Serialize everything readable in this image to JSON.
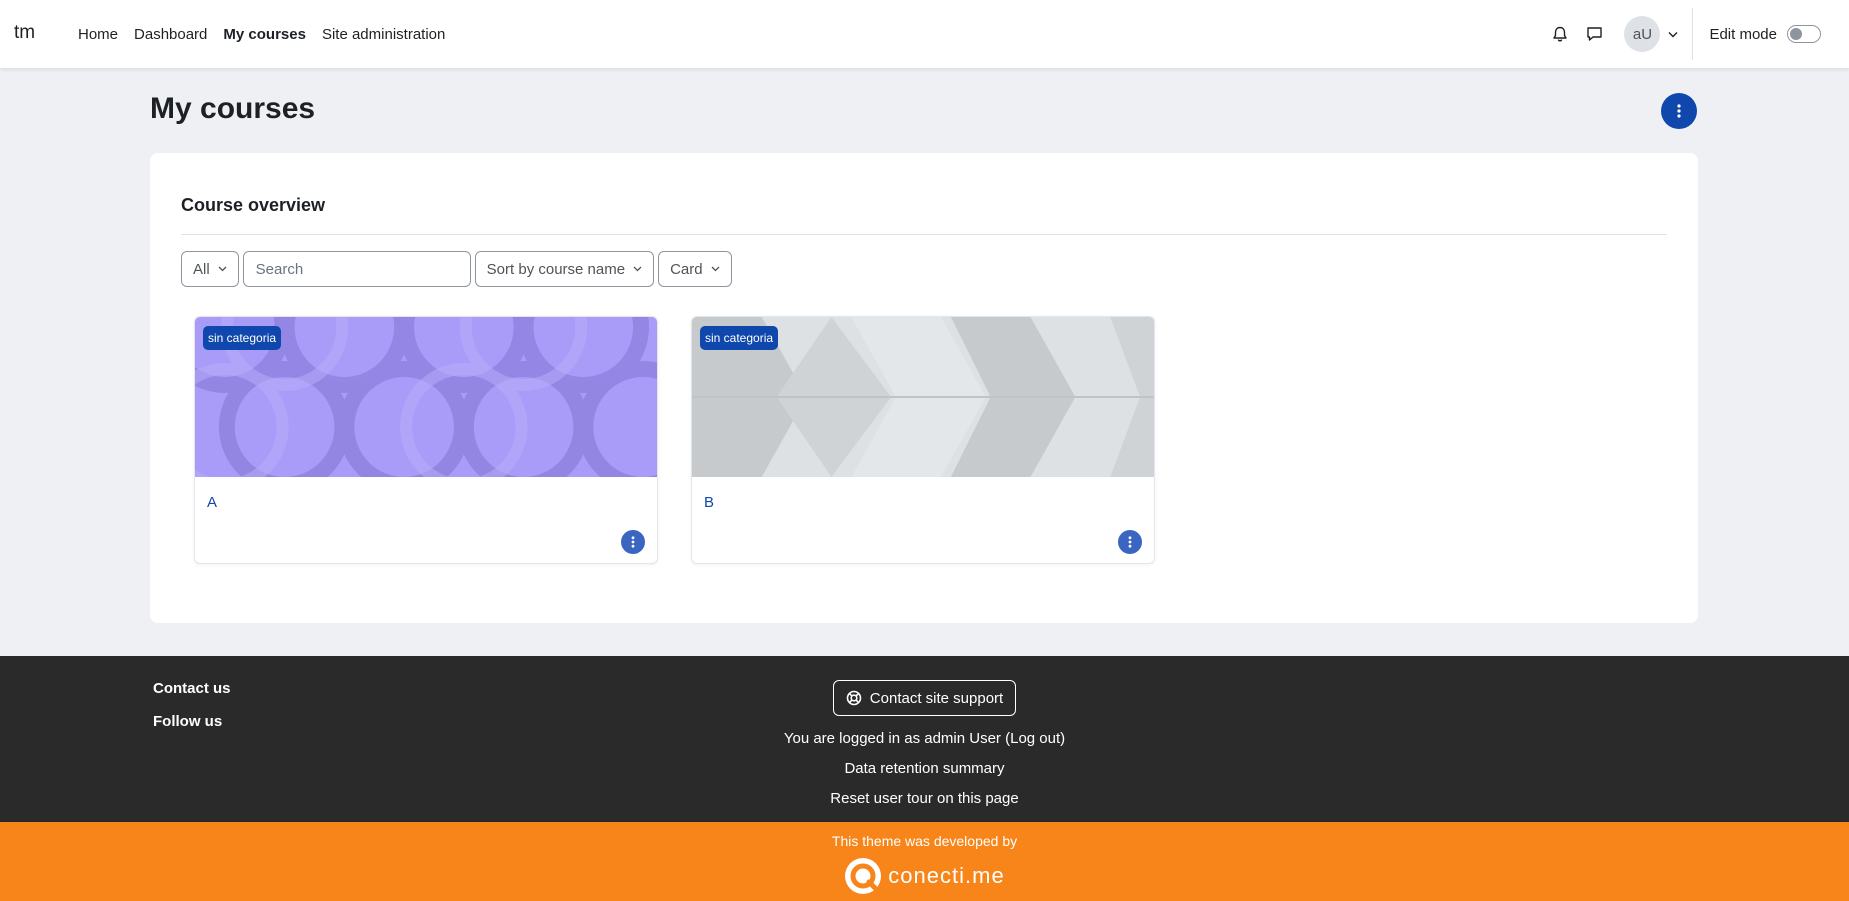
{
  "navbar": {
    "brand": "tm",
    "links": [
      {
        "label": "Home",
        "active": false
      },
      {
        "label": "Dashboard",
        "active": false
      },
      {
        "label": "My courses",
        "active": true
      },
      {
        "label": "Site administration",
        "active": false
      }
    ],
    "avatar_initials": "aU",
    "edit_mode_label": "Edit mode",
    "edit_mode_on": false
  },
  "page": {
    "title": "My courses"
  },
  "overview": {
    "title": "Course overview",
    "filter_all": "All",
    "search_placeholder": "Search",
    "sort_label": "Sort by course name",
    "view_label": "Card",
    "courses": [
      {
        "name": "A",
        "category": "sin categoria",
        "image_color": "#a99cf9"
      },
      {
        "name": "B",
        "category": "sin categoria",
        "image_color": "#dde1e4"
      }
    ]
  },
  "footer": {
    "contact_us": "Contact us",
    "follow_us": "Follow us",
    "support_button": "Contact site support",
    "logged_in_prefix": "You are logged in as ",
    "logged_in_user": "admin User",
    "logout_label": "(Log out)",
    "data_retention": "Data retention summary",
    "reset_tour": "Reset user tour on this page"
  },
  "theme_bar": {
    "note": "This theme was developed by",
    "brand_name": "conecti.me",
    "color": "#f7851a"
  },
  "colors": {
    "primary": "#0f47ad",
    "footer_bg": "#2a2a2a",
    "page_bg": "#eef0f4"
  }
}
